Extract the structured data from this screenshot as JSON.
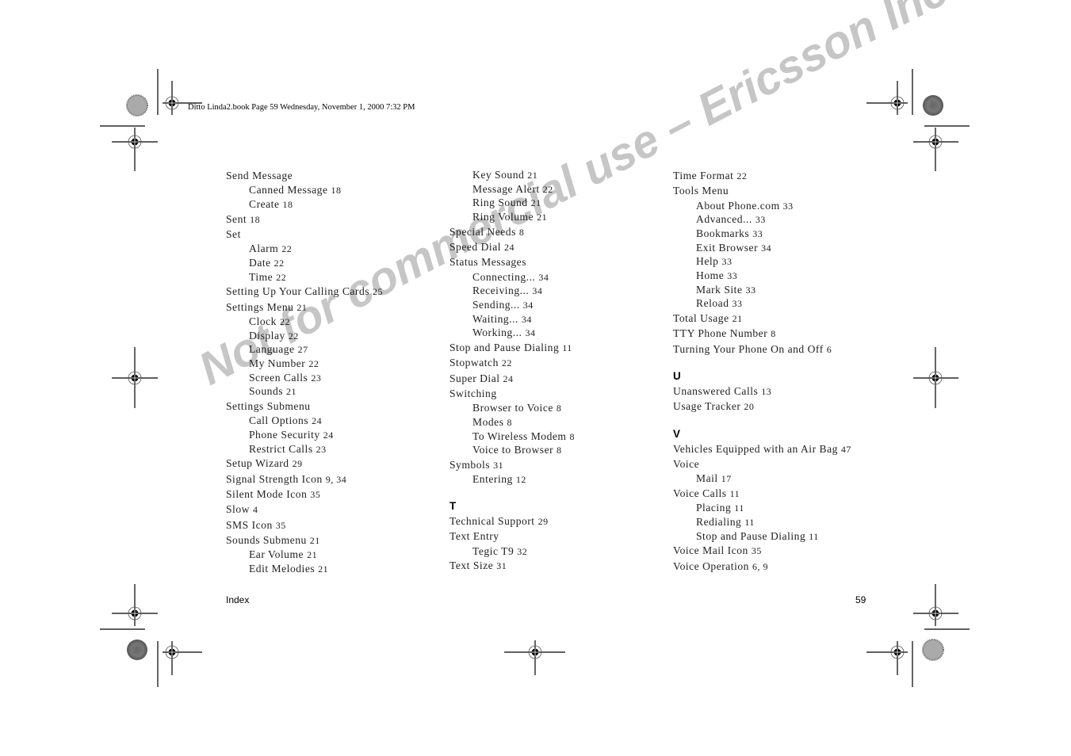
{
  "header": {
    "slug": "Ditto Linda2.book  Page 59  Wednesday, November 1, 2000  7:32 PM"
  },
  "watermark": "Not for commercial use – Ericsson Inc.",
  "columns": [
    {
      "entries": [
        {
          "text": "Send Message",
          "page": ""
        },
        {
          "text": "Canned Message",
          "page": "18",
          "sub": true
        },
        {
          "text": "Create",
          "page": "18",
          "sub": true
        },
        {
          "text": "Sent",
          "page": "18"
        },
        {
          "text": "Set",
          "page": ""
        },
        {
          "text": "Alarm",
          "page": "22",
          "sub": true
        },
        {
          "text": "Date",
          "page": "22",
          "sub": true
        },
        {
          "text": "Time",
          "page": "22",
          "sub": true
        },
        {
          "text": "Setting Up Your Calling Cards",
          "page": "25"
        },
        {
          "text": "Settings Menu",
          "page": "21"
        },
        {
          "text": "Clock",
          "page": "22",
          "sub": true
        },
        {
          "text": "Display",
          "page": "22",
          "sub": true
        },
        {
          "text": "Language",
          "page": "27",
          "sub": true
        },
        {
          "text": "My Number",
          "page": "22",
          "sub": true
        },
        {
          "text": "Screen Calls",
          "page": "23",
          "sub": true
        },
        {
          "text": "Sounds",
          "page": "21",
          "sub": true
        },
        {
          "text": "Settings Submenu",
          "page": ""
        },
        {
          "text": "Call Options",
          "page": "24",
          "sub": true
        },
        {
          "text": "Phone Security",
          "page": "24",
          "sub": true
        },
        {
          "text": "Restrict Calls",
          "page": "23",
          "sub": true
        },
        {
          "text": "Setup Wizard",
          "page": "29"
        },
        {
          "text": "Signal Strength Icon",
          "page": "9, 34"
        },
        {
          "text": "Silent Mode Icon",
          "page": "35"
        },
        {
          "text": "Slow",
          "page": "4"
        },
        {
          "text": "SMS Icon",
          "page": "35"
        },
        {
          "text": "Sounds Submenu",
          "page": "21"
        },
        {
          "text": "Ear Volume",
          "page": "21",
          "sub": true
        },
        {
          "text": "Edit Melodies",
          "page": "21",
          "sub": true
        }
      ]
    },
    {
      "entries": [
        {
          "text": "Key Sound",
          "page": "21",
          "sub": true
        },
        {
          "text": "Message Alert",
          "page": "22",
          "sub": true
        },
        {
          "text": "Ring Sound",
          "page": "21",
          "sub": true
        },
        {
          "text": "Ring Volume",
          "page": "21",
          "sub": true
        },
        {
          "text": "Special Needs",
          "page": "8"
        },
        {
          "text": "Speed Dial",
          "page": "24"
        },
        {
          "text": "Status Messages",
          "page": ""
        },
        {
          "text": "Connecting...",
          "page": "34",
          "sub": true
        },
        {
          "text": "Receiving...",
          "page": "34",
          "sub": true
        },
        {
          "text": "Sending...",
          "page": "34",
          "sub": true
        },
        {
          "text": "Waiting...",
          "page": "34",
          "sub": true
        },
        {
          "text": "Working...",
          "page": "34",
          "sub": true
        },
        {
          "text": "Stop and Pause Dialing",
          "page": "11"
        },
        {
          "text": "Stopwatch",
          "page": "22"
        },
        {
          "text": "Super Dial",
          "page": "24"
        },
        {
          "text": "Switching",
          "page": ""
        },
        {
          "text": "Browser to Voice",
          "page": "8",
          "sub": true
        },
        {
          "text": "Modes",
          "page": "8",
          "sub": true
        },
        {
          "text": "To Wireless Modem",
          "page": "8",
          "sub": true
        },
        {
          "text": "Voice to Browser",
          "page": "8",
          "sub": true
        },
        {
          "text": "Symbols",
          "page": "31"
        },
        {
          "text": "Entering",
          "page": "12",
          "sub": true
        },
        {
          "letter": "T"
        },
        {
          "text": "Technical Support",
          "page": "29"
        },
        {
          "text": "Text Entry",
          "page": ""
        },
        {
          "text": "Tegic T9",
          "page": "32",
          "sub": true
        },
        {
          "text": "Text Size",
          "page": "31"
        }
      ]
    },
    {
      "entries": [
        {
          "text": "Time Format",
          "page": "22"
        },
        {
          "text": "Tools Menu",
          "page": ""
        },
        {
          "text": "About Phone.com",
          "page": "33",
          "sub": true
        },
        {
          "text": "Advanced...",
          "page": "33",
          "sub": true
        },
        {
          "text": "Bookmarks",
          "page": "33",
          "sub": true
        },
        {
          "text": "Exit Browser",
          "page": "34",
          "sub": true
        },
        {
          "text": "Help",
          "page": "33",
          "sub": true
        },
        {
          "text": "Home",
          "page": "33",
          "sub": true
        },
        {
          "text": "Mark Site",
          "page": "33",
          "sub": true
        },
        {
          "text": "Reload",
          "page": "33",
          "sub": true
        },
        {
          "text": "Total Usage",
          "page": "21"
        },
        {
          "text": "TTY Phone Number",
          "page": "8"
        },
        {
          "text": "Turning Your Phone On and Off",
          "page": "6"
        },
        {
          "letter": "U"
        },
        {
          "text": "Unanswered Calls",
          "page": "13"
        },
        {
          "text": "Usage Tracker",
          "page": "20"
        },
        {
          "letter": "V"
        },
        {
          "text": "Vehicles Equipped with an Air Bag",
          "page": "47"
        },
        {
          "text": "Voice",
          "page": ""
        },
        {
          "text": "Mail",
          "page": "17",
          "sub": true
        },
        {
          "text": "Voice Calls",
          "page": "11"
        },
        {
          "text": "Placing",
          "page": "11",
          "sub": true
        },
        {
          "text": "Redialing",
          "page": "11",
          "sub": true
        },
        {
          "text": "Stop and Pause Dialing",
          "page": "11",
          "sub": true
        },
        {
          "text": "Voice Mail Icon",
          "page": "35"
        },
        {
          "text": "Voice Operation",
          "page": "6, 9"
        }
      ]
    }
  ],
  "footer": {
    "section": "Index",
    "page_number": "59"
  }
}
